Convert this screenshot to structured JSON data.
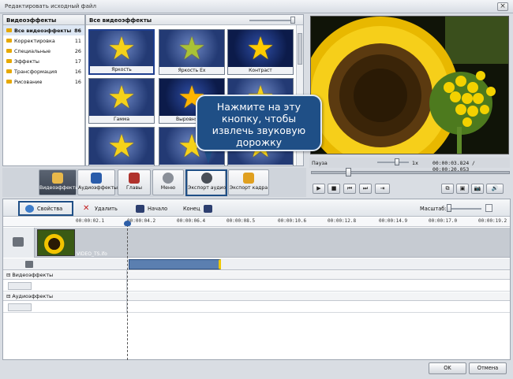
{
  "window": {
    "title": "Редактировать исходный файл",
    "close_label": "×"
  },
  "effects_panel": {
    "header": "Видеоэффекты",
    "categories": [
      {
        "label": "Все видеоэффекты",
        "count": "86"
      },
      {
        "label": "Корректировка",
        "count": "11"
      },
      {
        "label": "Специальные",
        "count": "26"
      },
      {
        "label": "Эффекты",
        "count": "17"
      },
      {
        "label": "Трансформация",
        "count": "16"
      },
      {
        "label": "Рисование",
        "count": "16"
      }
    ]
  },
  "grid_panel": {
    "header": "Все видеоэффекты",
    "tiles": [
      "Яркость",
      "Яркость Ex",
      "Контраст",
      "Гамма",
      "Выровнять я",
      "",
      "",
      "",
      ""
    ]
  },
  "tooltip": {
    "text": "Нажмите на эту кнопку, чтобы извлечь звуковую дорожку"
  },
  "player": {
    "status": "Пауза",
    "speed": "1x",
    "time": "00:00:03.824 / 00:00:20.053",
    "position_fraction": 0.19,
    "controls": [
      "▶",
      "■",
      "⏮",
      "⏭",
      "⇥"
    ],
    "right_controls": [
      "⧉",
      "▣",
      "📷",
      "🔊"
    ]
  },
  "tabs": [
    {
      "label": "Видеоэффекты",
      "icon": "video-effects-icon",
      "color": "#e8b84a",
      "active": true
    },
    {
      "label": "Аудиоэффекты",
      "icon": "audio-effects-icon",
      "color": "#2a5caa",
      "active": false
    },
    {
      "label": "Главы",
      "icon": "chapters-icon",
      "color": "#b0322c",
      "active": false
    },
    {
      "label": "Меню",
      "icon": "menu-icon",
      "color": "#8a8f98",
      "active": false
    },
    {
      "label": "Экспорт аудио",
      "icon": "export-audio-icon",
      "color": "#4a4f57",
      "active": false
    },
    {
      "label": "Экспорт кадра",
      "icon": "export-frame-icon",
      "color": "#e0a020",
      "active": false
    }
  ],
  "timeline_toolbar": {
    "properties": "Свойства",
    "delete": "Удалить",
    "start": "Начало",
    "end": "Конец",
    "scale_label": "Масштаб:"
  },
  "ruler": [
    "00:00:02.1",
    "00:00:04.2",
    "00:00:06.4",
    "00:00:08.5",
    "00:00:10.6",
    "00:00:12.8",
    "00:00:14.9",
    "00:00:17.0",
    "00:00:19.2"
  ],
  "tracks": {
    "clip_name": "VIDEO_TS.ifo",
    "video_effects": "Видеоэффекты",
    "audio_effects": "Аудиоэффекты"
  },
  "footer": {
    "ok": "OK",
    "cancel": "Отмена"
  },
  "colors": {
    "accent": "#1f4f86",
    "clip_audio": "#5b7fb0"
  }
}
